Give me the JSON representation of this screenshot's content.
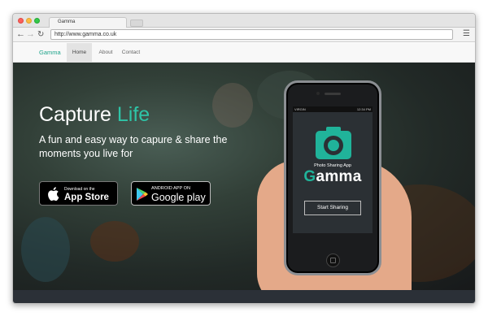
{
  "browser": {
    "tab_title": "Gamma",
    "url": "http://www.gamma.co.uk"
  },
  "site_nav": {
    "brand": "Gamma",
    "items": [
      {
        "label": "Home",
        "active": true
      },
      {
        "label": "About",
        "active": false
      },
      {
        "label": "Contact",
        "active": false
      }
    ]
  },
  "hero": {
    "headline_part1": "Capture",
    "headline_part2": "Life",
    "subheadline": "A fun and easy way to capure & share the moments you live for",
    "app_store": {
      "small": "Download on the",
      "big": "App Store"
    },
    "google_play": {
      "small": "ANDROID APP ON",
      "big": "Google play"
    }
  },
  "phone_screen": {
    "carrier": "VIRGIN",
    "time": "12:34 PM",
    "tagline": "Photo Sharing App",
    "app_name_first": "G",
    "app_name_rest": "amma",
    "button": "Start Sharing"
  },
  "colors": {
    "accent": "#2ec4a7",
    "brand": "#1fa38b"
  }
}
